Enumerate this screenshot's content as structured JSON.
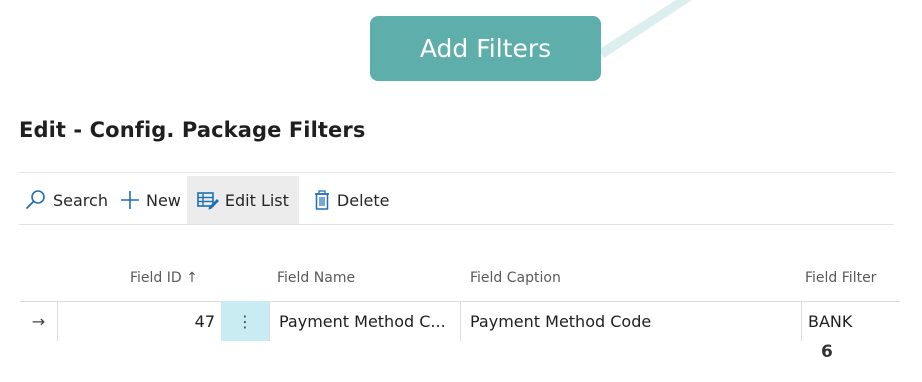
{
  "callout": {
    "label": "Add Filters"
  },
  "page": {
    "title": "Edit - Config. Package Filters"
  },
  "toolbar": {
    "search_label": "Search",
    "new_label": "New",
    "edit_list_label": "Edit List",
    "delete_label": "Delete"
  },
  "table": {
    "columns": [
      "Field ID",
      "Field Name",
      "Field Caption",
      "Field Filter"
    ],
    "sort_indicator": "↑",
    "rows": [
      {
        "row_indicator": "→",
        "field_id": "47",
        "menu": "⋮",
        "field_name": "Payment Method C...",
        "field_caption": "Payment Method Code",
        "field_filter": "BANK"
      }
    ]
  },
  "footnote": "6",
  "colors": {
    "callout_bg": "#5eaeab",
    "accent_blue": "#1f6fb5",
    "selected_cell_bg": "#c8ecf2"
  }
}
